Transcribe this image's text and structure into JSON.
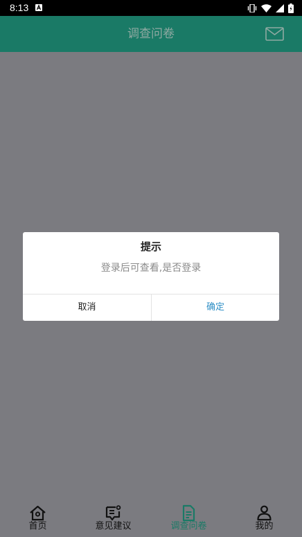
{
  "status_bar": {
    "time": "8:13",
    "notification_icon": "a-icon",
    "icons": [
      "vibrate-icon",
      "wifi-icon",
      "signal-icon",
      "battery-icon"
    ]
  },
  "header": {
    "title": "调查问卷",
    "mail_icon": "mail-icon"
  },
  "dialog": {
    "title": "提示",
    "message": "登录后可查看,是否登录",
    "cancel_label": "取消",
    "confirm_label": "确定"
  },
  "tabs": [
    {
      "label": "首页",
      "icon": "home-icon",
      "active": false
    },
    {
      "label": "意见建议",
      "icon": "feedback-icon",
      "active": false
    },
    {
      "label": "调查问卷",
      "icon": "document-icon",
      "active": true
    },
    {
      "label": "我的",
      "icon": "user-icon",
      "active": false
    }
  ],
  "colors": {
    "header_bg": "#1a7a66",
    "overlay": "#7b7b80",
    "confirm_text": "#2f8fc6",
    "active_tab": "#1a7a66"
  }
}
